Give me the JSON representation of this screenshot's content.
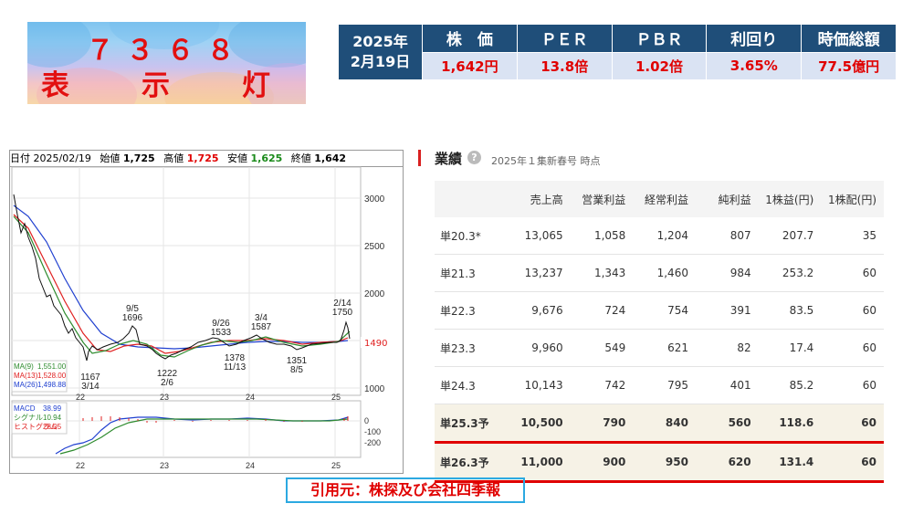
{
  "logo": {
    "code": "７３６８",
    "name": "表　示　灯"
  },
  "price_table": {
    "date_line1": "2025年",
    "date_line2": "2月19日",
    "headers": [
      "株　価",
      "ＰＥＲ",
      "ＰＢＲ",
      "利回り",
      "時価総額"
    ],
    "values": [
      "1,642円",
      "13.8倍",
      "1.02倍",
      "3.65%",
      "77.5億円"
    ]
  },
  "chart": {
    "info": {
      "date": "日付 2025/02/19",
      "open_label": "始値",
      "open": "1,725",
      "high_label": "高値",
      "high": "1,725",
      "low_label": "安値",
      "low": "1,625",
      "close_label": "終値",
      "close": "1,642"
    },
    "y_ticks": [
      "3000",
      "2500",
      "2000",
      "1500",
      "1000"
    ],
    "current_price": "1490",
    "x_ticks": [
      "22",
      "23",
      "24",
      "25"
    ],
    "annotations": [
      {
        "text": "1167"
      },
      {
        "text": "3/14"
      },
      {
        "text": "9/5"
      },
      {
        "text": "1696"
      },
      {
        "text": "1222"
      },
      {
        "text": "2/6"
      },
      {
        "text": "9/26"
      },
      {
        "text": "1533"
      },
      {
        "text": "1378"
      },
      {
        "text": "11/13"
      },
      {
        "text": "3/4"
      },
      {
        "text": "1587"
      },
      {
        "text": "1351"
      },
      {
        "text": "8/5"
      },
      {
        "text": "2/14"
      },
      {
        "text": "1750"
      }
    ],
    "legend": [
      {
        "label": "MA(9)",
        "value": "1,551.00",
        "color": "#2e8b2e"
      },
      {
        "label": "MA(13)",
        "value": "1,528.00",
        "color": "#e02020"
      },
      {
        "label": "MA(26)",
        "value": "1,498.88",
        "color": "#2040d0"
      }
    ],
    "macd_legend": [
      {
        "label": "MACD",
        "value": "38.99",
        "color": "#2040d0"
      },
      {
        "label": "シグナル",
        "value": "10.94",
        "color": "#2e8b2e"
      },
      {
        "label": "ヒストグラム",
        "value": "28.05",
        "color": "#e02020"
      }
    ],
    "macd_ticks": [
      "0",
      "-100",
      "-200"
    ]
  },
  "financials": {
    "title": "業績",
    "note": "2025年１集新春号 時点",
    "columns": [
      "",
      "売上高",
      "営業利益",
      "経常利益",
      "純利益",
      "1株益(円)",
      "1株配(円)"
    ],
    "rows": [
      {
        "period": "単20.3*",
        "cells": [
          "13,065",
          "1,058",
          "1,204",
          "807",
          "207.7",
          "35"
        ],
        "forecast": false
      },
      {
        "period": "単21.3",
        "cells": [
          "13,237",
          "1,343",
          "1,460",
          "984",
          "253.2",
          "60"
        ],
        "forecast": false
      },
      {
        "period": "単22.3",
        "cells": [
          "9,676",
          "724",
          "754",
          "391",
          "83.5",
          "60"
        ],
        "forecast": false
      },
      {
        "period": "単23.3",
        "cells": [
          "9,960",
          "549",
          "621",
          "82",
          "17.4",
          "60"
        ],
        "forecast": false
      },
      {
        "period": "単24.3",
        "cells": [
          "10,143",
          "742",
          "795",
          "401",
          "85.2",
          "60"
        ],
        "forecast": false
      },
      {
        "period": "単25.3予",
        "cells": [
          "10,500",
          "790",
          "840",
          "560",
          "118.6",
          "60"
        ],
        "forecast": true
      },
      {
        "period": "単26.3予",
        "cells": [
          "11,000",
          "900",
          "950",
          "620",
          "131.4",
          "60"
        ],
        "forecast": true
      }
    ]
  },
  "citation": "引用元：株探及び会社四季報"
}
